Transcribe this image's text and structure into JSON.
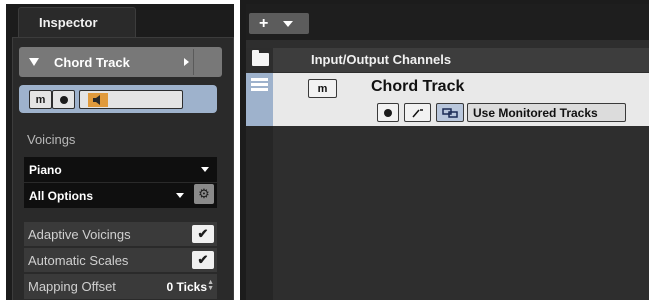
{
  "inspector": {
    "tab_label": "Inspector",
    "track_name": "Chord Track",
    "mute_label": "m",
    "voicings_label": "Voicings",
    "voicing_preset": "Piano",
    "voicing_options": "All Options",
    "options": [
      {
        "label": "Adaptive Voicings",
        "checked": true
      },
      {
        "label": "Automatic Scales",
        "checked": true
      }
    ],
    "mapping_offset_label": "Mapping Offset",
    "mapping_offset_value": "0 Ticks"
  },
  "tracklist": {
    "add_button": "+",
    "folder_track_name": "Input/Output Channels",
    "chord_track_name": "Chord Track",
    "mute_label": "m",
    "monitored_tracks_label": "Use Monitored Tracks"
  },
  "colors": {
    "selected_track": "#9eb2cc",
    "monitor_active": "#e09a3c"
  },
  "icons": [
    "triangle-down-icon",
    "chevron-right-icon",
    "record-icon",
    "speaker-icon",
    "caret-down-icon",
    "gear-icon",
    "checkmark-icon",
    "spinner-icon",
    "folder-icon",
    "chord-track-icon",
    "auto-link-icon",
    "link-icon"
  ]
}
